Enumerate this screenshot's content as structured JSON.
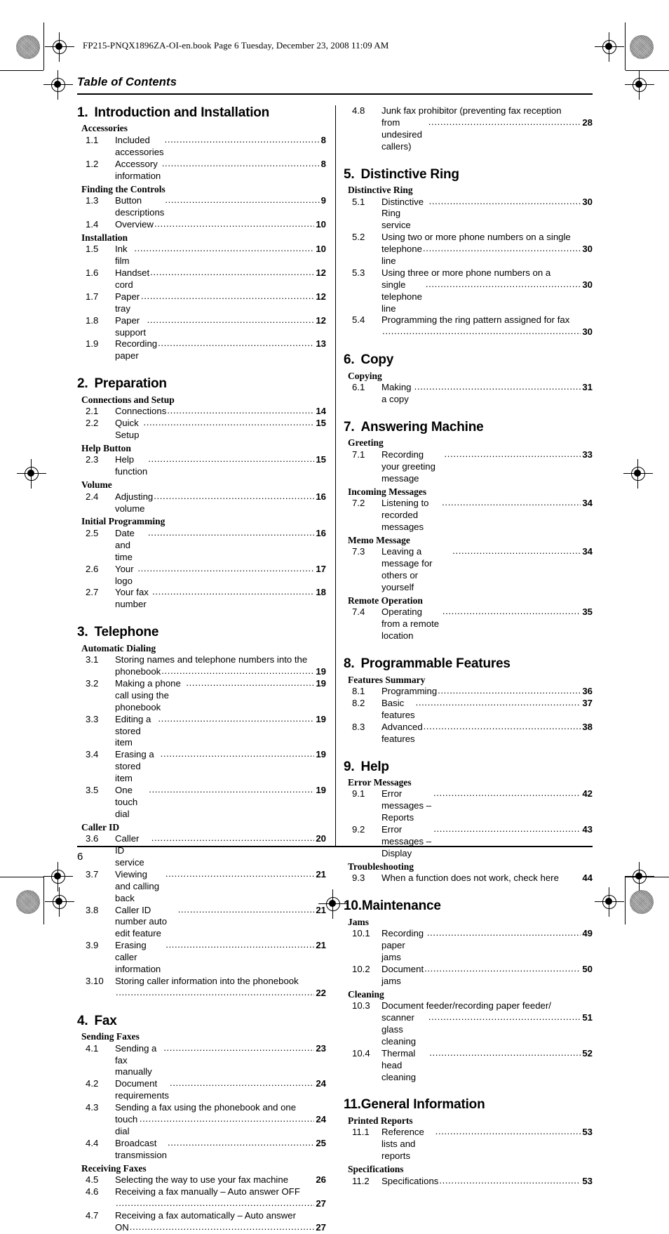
{
  "header": {
    "book_line": "FP215-PNQX1896ZA-OI-en.book  Page 6  Tuesday, December 23, 2008  11:09 AM",
    "title": "Table of Contents"
  },
  "footer": {
    "page_number": "6"
  },
  "left_column": [
    {
      "type": "chapter",
      "number": "1.",
      "title": "Introduction and Installation"
    },
    {
      "type": "group",
      "label": "Accessories"
    },
    {
      "type": "entry",
      "number": "1.1",
      "title": "Included accessories",
      "page": "8"
    },
    {
      "type": "entry",
      "number": "1.2",
      "title": "Accessory information",
      "page": "8"
    },
    {
      "type": "group",
      "label": "Finding the Controls"
    },
    {
      "type": "entry",
      "number": "1.3",
      "title": "Button descriptions",
      "page": "9"
    },
    {
      "type": "entry",
      "number": "1.4",
      "title": "Overview ",
      "page": "10"
    },
    {
      "type": "group",
      "label": "Installation"
    },
    {
      "type": "entry",
      "number": "1.5",
      "title": "Ink film ",
      "page": "10"
    },
    {
      "type": "entry",
      "number": "1.6",
      "title": "Handset cord",
      "page": "12"
    },
    {
      "type": "entry",
      "number": "1.7",
      "title": "Paper tray ",
      "page": "12"
    },
    {
      "type": "entry",
      "number": "1.8",
      "title": "Paper support",
      "page": "12"
    },
    {
      "type": "entry",
      "number": "1.9",
      "title": "Recording paper",
      "page": "13"
    },
    {
      "type": "chapter",
      "number": "2.",
      "title": "Preparation"
    },
    {
      "type": "group",
      "label": "Connections and Setup"
    },
    {
      "type": "entry",
      "number": "2.1",
      "title": "Connections ",
      "page": "14"
    },
    {
      "type": "entry",
      "number": "2.2",
      "title": "Quick Setup",
      "page": "15"
    },
    {
      "type": "group",
      "label": "Help Button"
    },
    {
      "type": "entry",
      "number": "2.3",
      "title": "Help function ",
      "page": "15"
    },
    {
      "type": "group",
      "label": "Volume"
    },
    {
      "type": "entry",
      "number": "2.4",
      "title": "Adjusting volume ",
      "page": "16"
    },
    {
      "type": "group",
      "label": "Initial Programming"
    },
    {
      "type": "entry",
      "number": "2.5",
      "title": "Date and time ",
      "page": "16"
    },
    {
      "type": "entry",
      "number": "2.6",
      "title": "Your logo",
      "page": "17"
    },
    {
      "type": "entry",
      "number": "2.7",
      "title": "Your fax number ",
      "page": "18"
    },
    {
      "type": "chapter",
      "number": "3.",
      "title": "Telephone"
    },
    {
      "type": "group",
      "label": "Automatic Dialing"
    },
    {
      "type": "entry",
      "number": "3.1",
      "lines": [
        "Storing names and telephone numbers into the"
      ],
      "title": "phonebook",
      "page": "19"
    },
    {
      "type": "entry",
      "number": "3.2",
      "title": "Making a phone call using the phonebook",
      "page": "19"
    },
    {
      "type": "entry",
      "number": "3.3",
      "title": "Editing a stored item",
      "page": "19"
    },
    {
      "type": "entry",
      "number": "3.4",
      "title": "Erasing a stored item ",
      "page": "19"
    },
    {
      "type": "entry",
      "number": "3.5",
      "title": "One touch dial ",
      "page": "19"
    },
    {
      "type": "group",
      "label": "Caller ID"
    },
    {
      "type": "entry",
      "number": "3.6",
      "title": "Caller ID service",
      "page": "20"
    },
    {
      "type": "entry",
      "number": "3.7",
      "title": "Viewing and calling back ",
      "page": "21"
    },
    {
      "type": "entry",
      "number": "3.8",
      "title": "Caller ID number auto edit feature ",
      "page": "21"
    },
    {
      "type": "entry",
      "number": "3.9",
      "title": "Erasing caller information",
      "page": "21"
    },
    {
      "type": "entry",
      "number": "3.10",
      "lines": [
        "Storing caller information into the phonebook"
      ],
      "title": "",
      "page": "22"
    },
    {
      "type": "chapter",
      "number": "4.",
      "title": "Fax"
    },
    {
      "type": "group",
      "label": "Sending Faxes"
    },
    {
      "type": "entry",
      "number": "4.1",
      "title": "Sending a fax manually ",
      "page": "23"
    },
    {
      "type": "entry",
      "number": "4.2",
      "title": "Document requirements ",
      "page": "24"
    },
    {
      "type": "entry",
      "number": "4.3",
      "lines": [
        "Sending a fax using the phonebook and one"
      ],
      "title": "touch dial ",
      "page": "24"
    },
    {
      "type": "entry",
      "number": "4.4",
      "title": "Broadcast transmission ",
      "page": "25"
    },
    {
      "type": "group",
      "label": "Receiving Faxes"
    },
    {
      "type": "entry",
      "number": "4.5",
      "title": "Selecting the way to use your fax machine ",
      "page": "26",
      "nodots": true
    },
    {
      "type": "entry",
      "number": "4.6",
      "lines": [
        "Receiving a fax manually – Auto answer OFF"
      ],
      "title": "",
      "page": "27"
    },
    {
      "type": "entry",
      "number": "4.7",
      "lines": [
        "Receiving a fax automatically – Auto answer"
      ],
      "title": "ON",
      "page": "27"
    }
  ],
  "right_column": [
    {
      "type": "entry",
      "number": "4.8",
      "lines": [
        "Junk fax prohibitor (preventing fax reception"
      ],
      "title": "from undesired callers)",
      "page": "28"
    },
    {
      "type": "chapter",
      "number": "5.",
      "title": "Distinctive Ring"
    },
    {
      "type": "group",
      "label": "Distinctive Ring"
    },
    {
      "type": "entry",
      "number": "5.1",
      "title": "Distinctive Ring service",
      "page": "30"
    },
    {
      "type": "entry",
      "number": "5.2",
      "lines": [
        "Using two or more phone numbers on a single"
      ],
      "title": "telephone line",
      "page": "30"
    },
    {
      "type": "entry",
      "number": "5.3",
      "lines": [
        "Using three or more phone numbers on a"
      ],
      "title": "single telephone line ",
      "page": "30"
    },
    {
      "type": "entry",
      "number": "5.4",
      "lines": [
        "Programming the ring pattern assigned for fax"
      ],
      "title": "",
      "page": "30"
    },
    {
      "type": "chapter",
      "number": "6.",
      "title": "Copy"
    },
    {
      "type": "group",
      "label": "Copying"
    },
    {
      "type": "entry",
      "number": "6.1",
      "title": "Making a copy",
      "page": "31"
    },
    {
      "type": "chapter",
      "number": "7.",
      "title": "Answering Machine"
    },
    {
      "type": "group",
      "label": "Greeting"
    },
    {
      "type": "entry",
      "number": "7.1",
      "title": "Recording your greeting message ",
      "page": "33"
    },
    {
      "type": "group",
      "label": "Incoming Messages"
    },
    {
      "type": "entry",
      "number": "7.2",
      "title": "Listening to recorded messages ",
      "page": "34"
    },
    {
      "type": "group",
      "label": "Memo Message"
    },
    {
      "type": "entry",
      "number": "7.3",
      "title": "Leaving a message for others or yourself ",
      "page": "34"
    },
    {
      "type": "group",
      "label": "Remote Operation"
    },
    {
      "type": "entry",
      "number": "7.4",
      "title": "Operating from a remote location",
      "page": "35"
    },
    {
      "type": "chapter",
      "number": "8.",
      "title": "Programmable Features"
    },
    {
      "type": "group",
      "label": "Features Summary"
    },
    {
      "type": "entry",
      "number": "8.1",
      "title": "Programming",
      "page": "36"
    },
    {
      "type": "entry",
      "number": "8.2",
      "title": "Basic features ",
      "page": "37"
    },
    {
      "type": "entry",
      "number": "8.3",
      "title": "Advanced features ",
      "page": "38"
    },
    {
      "type": "chapter",
      "number": "9.",
      "title": "Help"
    },
    {
      "type": "group",
      "label": "Error Messages"
    },
    {
      "type": "entry",
      "number": "9.1",
      "title": "Error messages – Reports",
      "page": "42"
    },
    {
      "type": "entry",
      "number": "9.2",
      "title": "Error messages – Display ",
      "page": "43"
    },
    {
      "type": "group",
      "label": "Troubleshooting"
    },
    {
      "type": "entry",
      "number": "9.3",
      "title": "When a function does not work, check here ",
      "page": "44",
      "nodots": true
    },
    {
      "type": "chapter",
      "number": "10.",
      "title": "Maintenance",
      "tight": true
    },
    {
      "type": "group",
      "label": "Jams"
    },
    {
      "type": "entry",
      "number": "10.1",
      "title": "Recording paper jams",
      "page": "49",
      "wide": true
    },
    {
      "type": "entry",
      "number": "10.2",
      "title": "Document jams ",
      "page": "50",
      "wide": true
    },
    {
      "type": "group",
      "label": "Cleaning"
    },
    {
      "type": "entry",
      "number": "10.3",
      "lines": [
        "Document feeder/recording paper feeder/"
      ],
      "title": "scanner glass cleaning",
      "page": "51",
      "wide": true
    },
    {
      "type": "entry",
      "number": "10.4",
      "title": "Thermal head cleaning ",
      "page": "52",
      "wide": true
    },
    {
      "type": "chapter",
      "number": "11.",
      "title": "General Information",
      "tight": true
    },
    {
      "type": "group",
      "label": "Printed Reports"
    },
    {
      "type": "entry",
      "number": "11.1",
      "title": "Reference lists and reports ",
      "page": "53",
      "wide": true
    },
    {
      "type": "group",
      "label": "Specifications"
    },
    {
      "type": "entry",
      "number": "11.2",
      "title": "Specifications",
      "page": "53",
      "wide": true
    }
  ]
}
